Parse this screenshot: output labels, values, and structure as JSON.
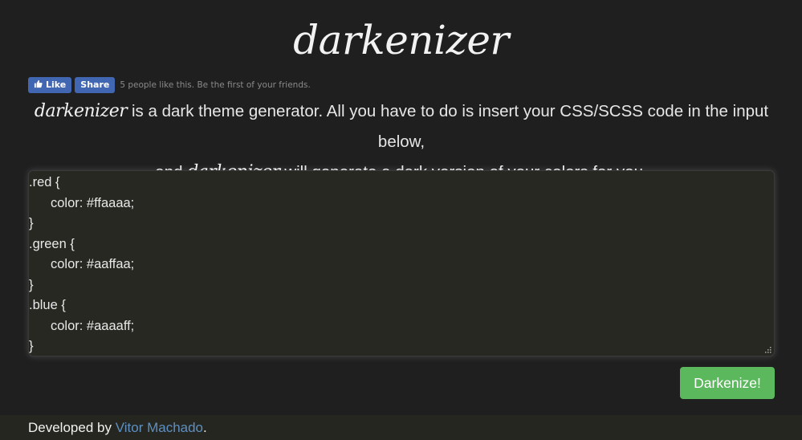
{
  "header": {
    "title": "darkenizer"
  },
  "facebook": {
    "like_label": "Like",
    "share_label": "Share",
    "social_text": "5 people like this. Be the first of your friends."
  },
  "intro": {
    "brand": "darkenizer",
    "line1_rest": "is a dark theme generator. All you have to do is insert your CSS/SCSS code in the input below,",
    "line2_prefix": "and",
    "line2_brand": "darkenizer",
    "line2_rest": "will generate a dark version of your colors for you."
  },
  "editor": {
    "lines": [
      ".red {",
      "color: #ffaaaa;",
      "}",
      ".green {",
      "color: #aaffaa;",
      "}",
      ".blue {",
      "color: #aaaaff;",
      "}"
    ]
  },
  "actions": {
    "darkenize_label": "Darkenize!"
  },
  "footer": {
    "prefix": "Developed by",
    "author_link": "Vitor Machado",
    "suffix": "."
  },
  "colors": {
    "background": "#1f1f1f",
    "editor_background": "#272822",
    "button_green": "#5cb85c",
    "facebook_blue": "#4267b2",
    "link_blue": "#5d8fc0"
  },
  "icons": {
    "like": "thumbs-up-icon",
    "resize": "resize-grip-icon"
  }
}
